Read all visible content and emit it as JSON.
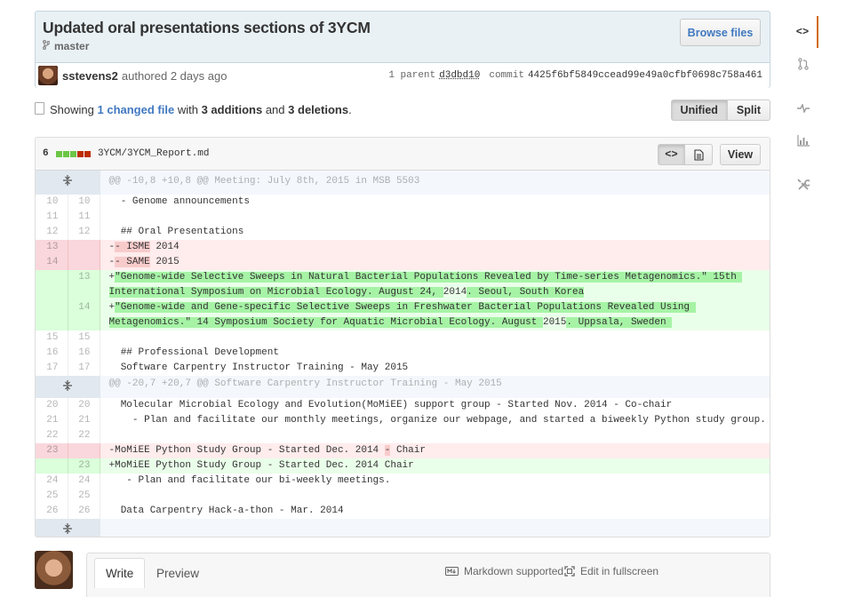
{
  "commit": {
    "title": "Updated oral presentations sections of 3YCM",
    "branch": "master",
    "browse_label": "Browse files",
    "author": "sstevens2",
    "authored_text": "authored 2 days ago",
    "parent_label": "1 parent",
    "parent_sha": "d3dbd10",
    "commit_label": "commit",
    "commit_sha": "4425f6bf5849ccead99e49a0cfbf0698c758a461"
  },
  "toc": {
    "showing": "Showing",
    "changed_files": "1 changed file",
    "with": "with",
    "additions": "3 additions",
    "and": "and",
    "deletions": "3 deletions",
    "period": ".",
    "unified_label": "Unified",
    "split_label": "Split"
  },
  "file": {
    "stat_count": "6",
    "path": "3YCM/3YCM_Report.md",
    "view_label": "View",
    "code_icon": "<>",
    "lines": [
      {
        "type": "hunk",
        "text": "@@ -10,8 +10,8 @@ Meeting: July 8th, 2015 in MSB 5503"
      },
      {
        "type": "ctx",
        "old": "10",
        "new": "10",
        "text": "  - Genome announcements"
      },
      {
        "type": "ctx",
        "old": "11",
        "new": "11",
        "text": ""
      },
      {
        "type": "ctx",
        "old": "12",
        "new": "12",
        "text": "  ## Oral Presentations"
      },
      {
        "type": "del",
        "old": "13",
        "new": "",
        "pre": "-",
        "hl": "- ISME",
        "post": " 2014"
      },
      {
        "type": "del",
        "old": "14",
        "new": "",
        "pre": "-",
        "hl": "- SAME",
        "post": " 2015"
      },
      {
        "type": "add",
        "old": "",
        "new": "13",
        "pre": "+",
        "hl": "\"Genome-wide Selective Sweeps in Natural Bacterial Populations Revealed by Time-series Metagenomics.\" 15th International Symposium on Microbial Ecology. August 24, ",
        "post": "2014",
        "hl2": ". Seoul, South Korea"
      },
      {
        "type": "add",
        "old": "",
        "new": "14",
        "pre": "+",
        "hl": "\"Genome-wide and Gene-specific Selective Sweeps in Freshwater Bacterial Populations Revealed Using Metagenomics.\" 14 Symposium Society for Aquatic Microbial Ecology. August ",
        "post": "2015",
        "hl2": ". Uppsala, Sweden "
      },
      {
        "type": "ctx",
        "old": "15",
        "new": "15",
        "text": ""
      },
      {
        "type": "ctx",
        "old": "16",
        "new": "16",
        "text": "  ## Professional Development"
      },
      {
        "type": "ctx",
        "old": "17",
        "new": "17",
        "text": "  Software Carpentry Instructor Training - May 2015"
      },
      {
        "type": "hunk",
        "text": "@@ -20,7 +20,7 @@ Software Carpentry Instructor Training - May 2015"
      },
      {
        "type": "ctx",
        "old": "20",
        "new": "20",
        "text": "  Molecular Microbial Ecology and Evolution(MoMiEE) support group - Started Nov. 2014 - Co-chair"
      },
      {
        "type": "ctx",
        "old": "21",
        "new": "21",
        "text": "    - Plan and facilitate our monthly meetings, organize our webpage, and started a biweekly Python study group."
      },
      {
        "type": "ctx",
        "old": "22",
        "new": "22",
        "text": ""
      },
      {
        "type": "del",
        "old": "23",
        "new": "",
        "pre": "-MoMiEE Python Study Group - Started Dec. 2014 ",
        "hl": "-",
        "post": " Chair"
      },
      {
        "type": "add",
        "old": "",
        "new": "23",
        "pre": "+MoMiEE Python Study Group - Started Dec. 2014 Chair",
        "hl": "",
        "post": "",
        "hl2": ""
      },
      {
        "type": "ctx",
        "old": "24",
        "new": "24",
        "text": "   - Plan and facilitate our bi-weekly meetings."
      },
      {
        "type": "ctx",
        "old": "25",
        "new": "25",
        "text": ""
      },
      {
        "type": "ctx",
        "old": "26",
        "new": "26",
        "text": "  Data Carpentry Hack-a-thon - Mar. 2014"
      },
      {
        "type": "hunk",
        "text": ""
      }
    ]
  },
  "comment": {
    "write_tab": "Write",
    "preview_tab": "Preview",
    "markdown_label": "Markdown supported",
    "fullscreen_label": "Edit in fullscreen"
  },
  "sidebar": {
    "items": [
      "code-icon",
      "pull-request-icon",
      "pulse-icon",
      "graph-icon",
      "tools-icon"
    ]
  },
  "colors": {
    "deletion": "#ffecec",
    "addition": "#eaffea",
    "link": "#4078c0",
    "active_tab": "#d26911"
  }
}
